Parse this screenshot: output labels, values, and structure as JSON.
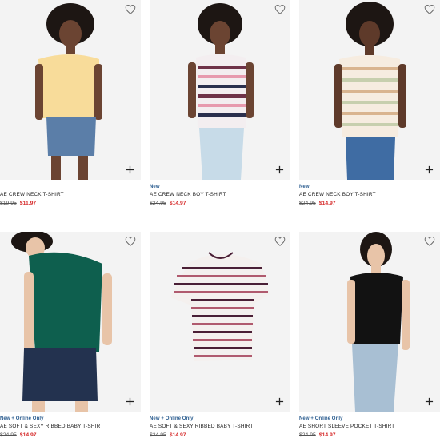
{
  "products": [
    {
      "badge": "",
      "name": "AE CREW NECK T-SHIRT",
      "was": "$19.95",
      "now": "$11.97",
      "shirt_color": "#f8dc9a",
      "stripes": []
    },
    {
      "badge": "New",
      "name": "AE CREW NECK BOY T-SHIRT",
      "was": "$24.95",
      "now": "$14.97",
      "shirt_color": "#f3eef0",
      "stripes": [
        "#6f3248",
        "#e79aae",
        "#2a2f4d"
      ]
    },
    {
      "badge": "New",
      "name": "AE CREW NECK BOY T-SHIRT",
      "was": "$24.95",
      "now": "$14.97",
      "shirt_color": "#f6ece0",
      "stripes": [
        "#d9b48f",
        "#c7cfae"
      ]
    },
    {
      "badge": "New + Online Only",
      "name": "AE SOFT & SEXY RIBBED BABY T-SHIRT",
      "was": "$24.95",
      "now": "$14.97",
      "shirt_color": "#0e5f4e",
      "stripes": []
    },
    {
      "badge": "New + Online Only",
      "name": "AE SOFT & SEXY RIBBED BABY T-SHIRT",
      "was": "$24.95",
      "now": "$14.97",
      "shirt_color": "#f4f0ee",
      "stripes": [
        "#4a1f36",
        "#b05a6e"
      ]
    },
    {
      "badge": "New + Online Only",
      "name": "AE SHORT SLEEVE POCKET T-SHIRT",
      "was": "$24.95",
      "now": "$14.97",
      "shirt_color": "#121212",
      "stripes": []
    }
  ],
  "icons": {
    "favorite": "heart-outline-icon",
    "quick_add": "plus-icon"
  }
}
